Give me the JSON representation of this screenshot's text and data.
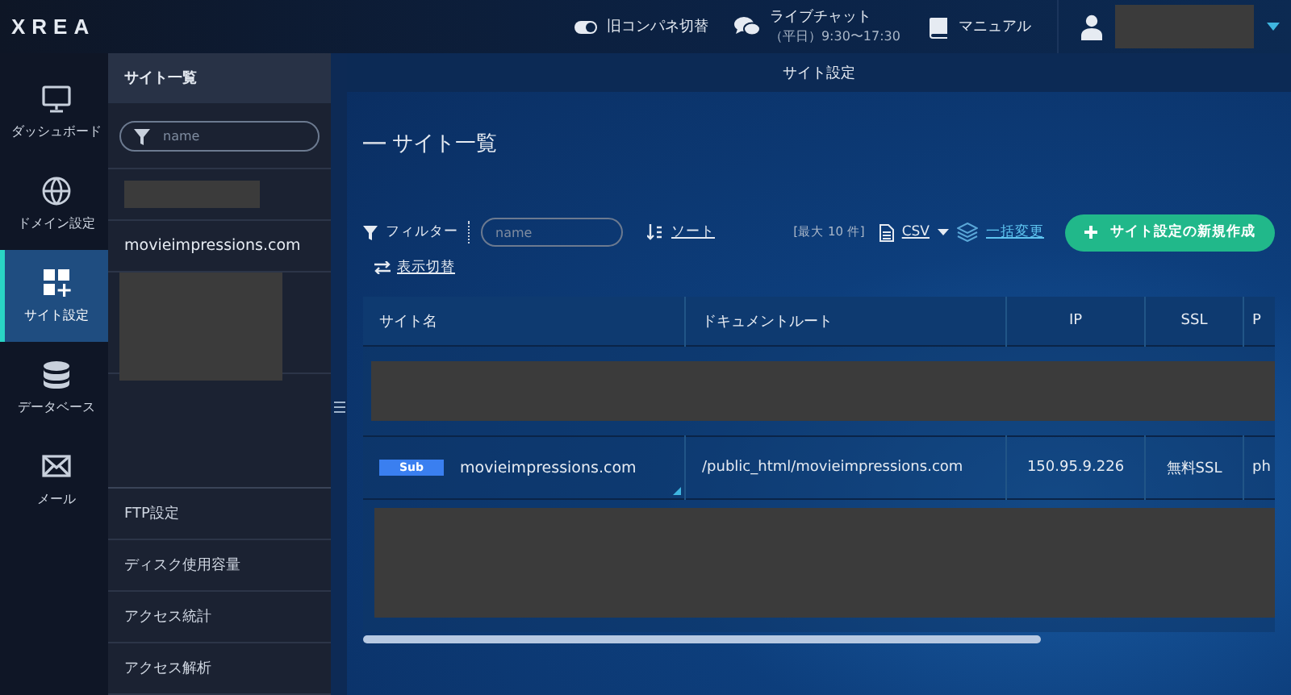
{
  "topbar": {
    "logo": "XREA",
    "legacy_toggle": {
      "label": "旧コンパネ切替",
      "on": true
    },
    "chat": {
      "label": "ライブチャット",
      "hours": "（平日）9:30〜17:30"
    },
    "manual": {
      "label": "マニュアル"
    },
    "user": {
      "kind": "redacted"
    }
  },
  "nav": [
    {
      "label": "ダッシュボード",
      "kind": "monitor",
      "selected": false
    },
    {
      "label": "ドメイン設定",
      "kind": "globe",
      "selected": false
    },
    {
      "label": "サイト設定",
      "kind": "grid",
      "selected": true
    },
    {
      "label": "データベース",
      "kind": "database",
      "selected": false
    },
    {
      "label": "メール",
      "kind": "mail",
      "selected": false
    }
  ],
  "subnav": {
    "title": "サイト一覧",
    "search": {
      "placeholder": "name"
    },
    "sites": [
      {
        "kind": "redacted"
      },
      {
        "kind": "site",
        "label": "movieimpressions.com"
      },
      {
        "kind": "redacted_tall"
      }
    ],
    "menu": [
      {
        "label": "FTP設定"
      },
      {
        "label": "ディスク使用容量"
      },
      {
        "label": "アクセス統計"
      },
      {
        "label": "アクセス解析"
      }
    ]
  },
  "main": {
    "header": "サイト設定",
    "title": "サイト一覧",
    "toolbar": {
      "filter_label": "フィルター",
      "filter_placeholder": "name",
      "sort": "ソート",
      "max_count": "[最大 10 件]",
      "csv": "CSV",
      "bulk_edit": "一括変更",
      "create_button": "サイト設定の新規作成",
      "view_toggle": "表示切替"
    },
    "table": {
      "columns": [
        "サイト名",
        "ドキュメントルート",
        "IP",
        "SSL",
        "P"
      ],
      "rows": [
        {
          "kind": "redacted"
        },
        {
          "kind": "site",
          "badge": "Sub",
          "cells": [
            "movieimpressions.com",
            "/public_html/movieimpressions.com",
            "150.95.9.226",
            "無料SSL",
            "ph"
          ]
        },
        {
          "kind": "redacted_tall"
        }
      ]
    }
  }
}
